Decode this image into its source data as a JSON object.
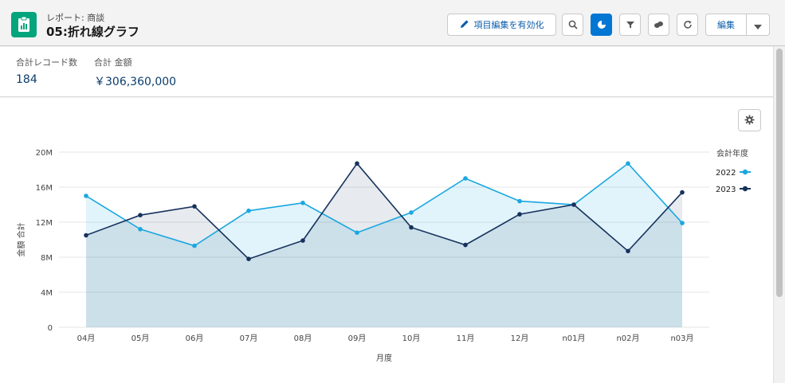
{
  "header": {
    "subtitle": "レポート: 商談",
    "title": "05:折れ線グラフ",
    "edit_fields_label": "項目編集を有効化",
    "edit_label": "編集"
  },
  "summary": {
    "record_count_label": "合計レコード数",
    "record_count_value": "184",
    "amount_label": "合計 金額",
    "amount_value": "￥306,360,000"
  },
  "chart_data": {
    "type": "area",
    "categories": [
      "04月",
      "05月",
      "06月",
      "07月",
      "08月",
      "09月",
      "10月",
      "11月",
      "12月",
      "n01月",
      "n02月",
      "n03月"
    ],
    "xlabel": "月度",
    "ylabel": "金額 合計",
    "ylim": [
      0,
      20000000
    ],
    "yticks": [
      "0",
      "4M",
      "8M",
      "12M",
      "16M",
      "20M"
    ],
    "legend_title": "会計年度",
    "legend_position": "right",
    "grid": true,
    "series": [
      {
        "name": "2022",
        "color": "#1ba7e0",
        "values": [
          15000000,
          11200000,
          9300000,
          13300000,
          14200000,
          10800000,
          13100000,
          17000000,
          14400000,
          14000000,
          18700000,
          11900000
        ]
      },
      {
        "name": "2023",
        "color": "#16325c",
        "values": [
          10500000,
          12800000,
          13800000,
          7800000,
          9900000,
          18700000,
          11400000,
          9400000,
          12900000,
          14000000,
          8700000,
          15400000
        ]
      }
    ]
  }
}
